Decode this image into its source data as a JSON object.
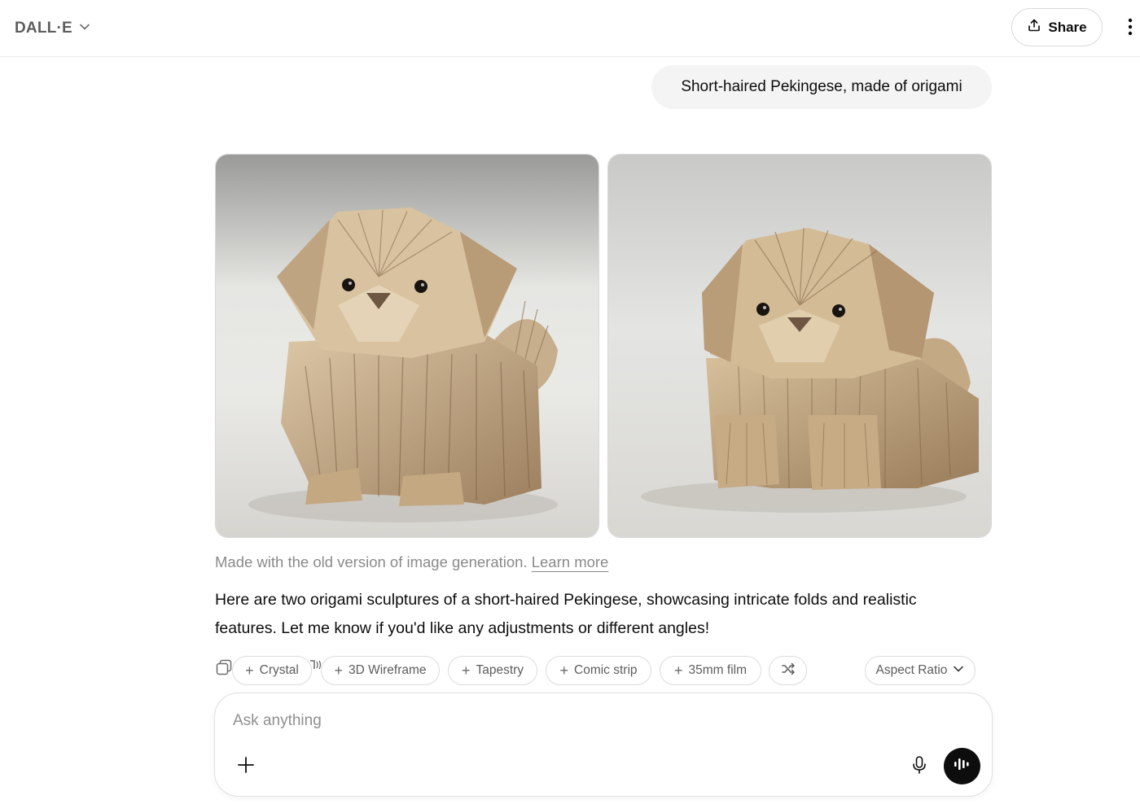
{
  "header": {
    "model_name": "DALL·E",
    "model_chevron_icon": "chevron-down-icon",
    "share_label": "Share",
    "share_icon": "share-upload-icon",
    "more_icon": "vertical-ellipsis-icon"
  },
  "conversation": {
    "user_message": "Short-haired Pekingese, made of origami",
    "images": [
      {
        "subject": "origami Pekingese dog, front-left view"
      },
      {
        "subject": "origami Pekingese dog, front view"
      }
    ],
    "note_text": "Made with the old version of image generation.",
    "note_link": "Learn more",
    "assistant_reply": "Here are two origami sculptures of a short-haired Pekingese, showcasing intricate folds and realistic features. Let me know if you'd like any adjustments or different angles!"
  },
  "styles": {
    "chips": [
      "Crystal",
      "3D Wireframe",
      "Tapestry",
      "Comic strip",
      "35mm film"
    ],
    "shuffle_icon": "shuffle-icon",
    "aspect_ratio_label": "Aspect Ratio"
  },
  "composer": {
    "placeholder": "Ask anything",
    "value": ""
  },
  "colors": {
    "accent_dark": "#0d0d0d",
    "bubble_bg": "#f4f4f4",
    "muted_text": "#8a8a8a",
    "paper": "#c9b08a"
  }
}
